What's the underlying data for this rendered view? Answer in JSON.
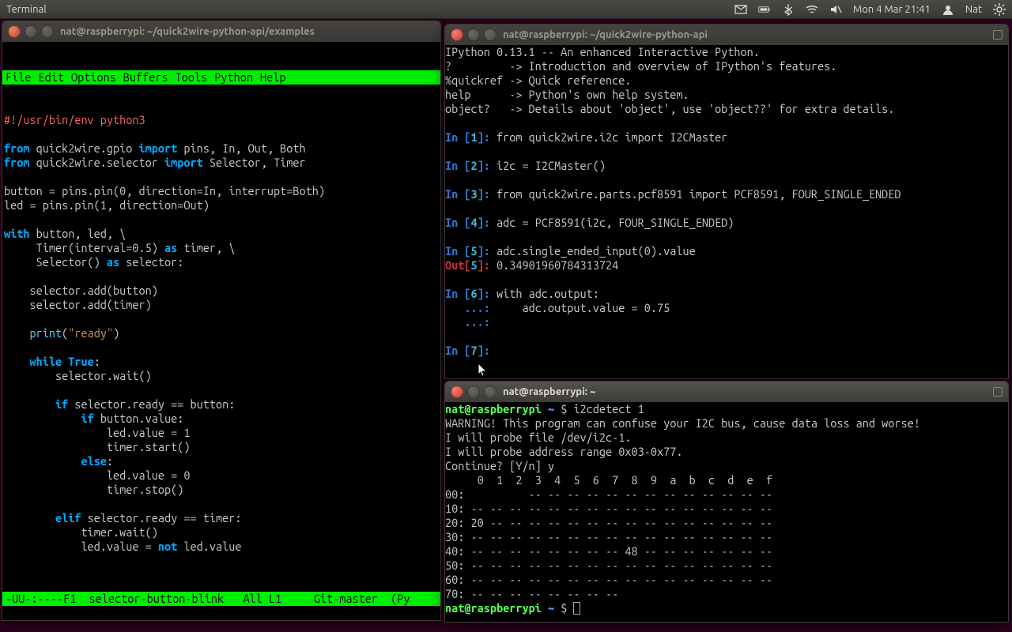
{
  "panel": {
    "app": "Terminal",
    "datetime": "Mon  4 Mar 21:41",
    "user": "Nat"
  },
  "emacs_window": {
    "title": "nat@raspberrypi: ~/quick2wire-python-api/examples",
    "menu": [
      "File",
      "Edit",
      "Options",
      "Buffers",
      "Tools",
      "Python",
      "Help"
    ],
    "shebang": "#!/usr/bin/env python3",
    "code": [
      {
        "t": "blank"
      },
      {
        "t": "line",
        "frags": [
          [
            "kw",
            "from"
          ],
          [
            "pl",
            " quick2wire.gpio "
          ],
          [
            "kw",
            "import"
          ],
          [
            "pl",
            " pins, In, Out, Both"
          ]
        ]
      },
      {
        "t": "line",
        "frags": [
          [
            "kw",
            "from"
          ],
          [
            "pl",
            " quick2wire.selector "
          ],
          [
            "kw",
            "import"
          ],
          [
            "pl",
            " Selector, Timer"
          ]
        ]
      },
      {
        "t": "blank"
      },
      {
        "t": "line",
        "frags": [
          [
            "pl",
            "button = pins.pin(0, direction=In, interrupt=Both)"
          ]
        ]
      },
      {
        "t": "line",
        "frags": [
          [
            "pl",
            "led = pins.pin(1, direction=Out)"
          ]
        ]
      },
      {
        "t": "blank"
      },
      {
        "t": "line",
        "frags": [
          [
            "kw",
            "with"
          ],
          [
            "pl",
            " button, led, \\"
          ]
        ]
      },
      {
        "t": "line",
        "frags": [
          [
            "pl",
            "     Timer(interval=0.5) "
          ],
          [
            "kw",
            "as"
          ],
          [
            "pl",
            " timer, \\"
          ]
        ]
      },
      {
        "t": "line",
        "frags": [
          [
            "pl",
            "     Selector() "
          ],
          [
            "kw",
            "as"
          ],
          [
            "pl",
            " selector:"
          ]
        ]
      },
      {
        "t": "blank"
      },
      {
        "t": "line",
        "frags": [
          [
            "pl",
            "    selector.add(button)"
          ]
        ]
      },
      {
        "t": "line",
        "frags": [
          [
            "pl",
            "    selector.add(timer)"
          ]
        ]
      },
      {
        "t": "blank"
      },
      {
        "t": "line",
        "frags": [
          [
            "pl",
            "    "
          ],
          [
            "builtin",
            "print"
          ],
          [
            "pl",
            "("
          ],
          [
            "str",
            "\"ready\""
          ],
          [
            "pl",
            ")"
          ]
        ]
      },
      {
        "t": "blank"
      },
      {
        "t": "line",
        "frags": [
          [
            "pl",
            "    "
          ],
          [
            "kw",
            "while"
          ],
          [
            "pl",
            " "
          ],
          [
            "kw",
            "True"
          ],
          [
            "pl",
            ":"
          ]
        ]
      },
      {
        "t": "line",
        "frags": [
          [
            "pl",
            "        selector.wait()"
          ]
        ]
      },
      {
        "t": "blank"
      },
      {
        "t": "line",
        "frags": [
          [
            "pl",
            "        "
          ],
          [
            "kw",
            "if"
          ],
          [
            "pl",
            " selector.ready == button:"
          ]
        ]
      },
      {
        "t": "line",
        "frags": [
          [
            "pl",
            "            "
          ],
          [
            "kw",
            "if"
          ],
          [
            "pl",
            " button.value:"
          ]
        ]
      },
      {
        "t": "line",
        "frags": [
          [
            "pl",
            "                led.value = 1"
          ]
        ]
      },
      {
        "t": "line",
        "frags": [
          [
            "pl",
            "                timer.start()"
          ]
        ]
      },
      {
        "t": "line",
        "frags": [
          [
            "pl",
            "            "
          ],
          [
            "kw",
            "else"
          ],
          [
            "pl",
            ":"
          ]
        ]
      },
      {
        "t": "line",
        "frags": [
          [
            "pl",
            "                led.value = 0"
          ]
        ]
      },
      {
        "t": "line",
        "frags": [
          [
            "pl",
            "                timer.stop()"
          ]
        ]
      },
      {
        "t": "blank"
      },
      {
        "t": "line",
        "frags": [
          [
            "pl",
            "        "
          ],
          [
            "kw",
            "elif"
          ],
          [
            "pl",
            " selector.ready == timer:"
          ]
        ]
      },
      {
        "t": "line",
        "frags": [
          [
            "pl",
            "            timer.wait()"
          ]
        ]
      },
      {
        "t": "line",
        "frags": [
          [
            "pl",
            "            led.value = "
          ],
          [
            "kw",
            "not"
          ],
          [
            "pl",
            " led.value"
          ]
        ]
      }
    ],
    "status": "-UU-:----F1  selector-button-blink   All L1     Git-master  (Py"
  },
  "ipython_window": {
    "title": "nat@raspberrypi: ~/quick2wire-python-api",
    "banner": [
      "IPython 0.13.1 -- An enhanced Interactive Python.",
      "?         -> Introduction and overview of IPython's features.",
      "%quickref -> Quick reference.",
      "help      -> Python's own help system.",
      "object?   -> Details about 'object', use 'object??' for extra details."
    ],
    "cells": [
      {
        "in": 1,
        "code": "from quick2wire.i2c import I2CMaster"
      },
      {
        "in": 2,
        "code": "i2c = I2CMaster()"
      },
      {
        "in": 3,
        "code": "from quick2wire.parts.pcf8591 import PCF8591, FOUR_SINGLE_ENDED"
      },
      {
        "in": 4,
        "code": "adc = PCF8591(i2c, FOUR_SINGLE_ENDED)"
      },
      {
        "in": 5,
        "code": "adc.single_ended_input(0).value",
        "out": "0.34901960784313724"
      },
      {
        "in": 6,
        "code": "with adc.output:",
        "cont": [
          "    adc.output.value = 0.75",
          ""
        ]
      },
      {
        "in": 7,
        "code": ""
      }
    ]
  },
  "shell_window": {
    "title": "nat@raspberrypi: ~",
    "prompt_user": "nat@raspberrypi",
    "prompt_path": "~",
    "command": "i2cdetect 1",
    "output": [
      "WARNING! This program can confuse your I2C bus, cause data loss and worse!",
      "I will probe file /dev/i2c-1.",
      "I will probe address range 0x03-0x77.",
      "Continue? [Y/n] y",
      "     0  1  2  3  4  5  6  7  8  9  a  b  c  d  e  f",
      "00:          -- -- -- -- -- -- -- -- -- -- -- -- --",
      "10: -- -- -- -- -- -- -- -- -- -- -- -- -- -- -- --",
      "20: 20 -- -- -- -- -- -- -- -- -- -- -- -- -- -- --",
      "30: -- -- -- -- -- -- -- -- -- -- -- -- -- -- -- --",
      "40: -- -- -- -- -- -- -- -- 48 -- -- -- -- -- -- --",
      "50: -- -- -- -- -- -- -- -- -- -- -- -- -- -- -- --",
      "60: -- -- -- -- -- -- -- -- -- -- -- -- -- -- -- --",
      "70: -- -- -- -- -- -- -- --"
    ]
  }
}
